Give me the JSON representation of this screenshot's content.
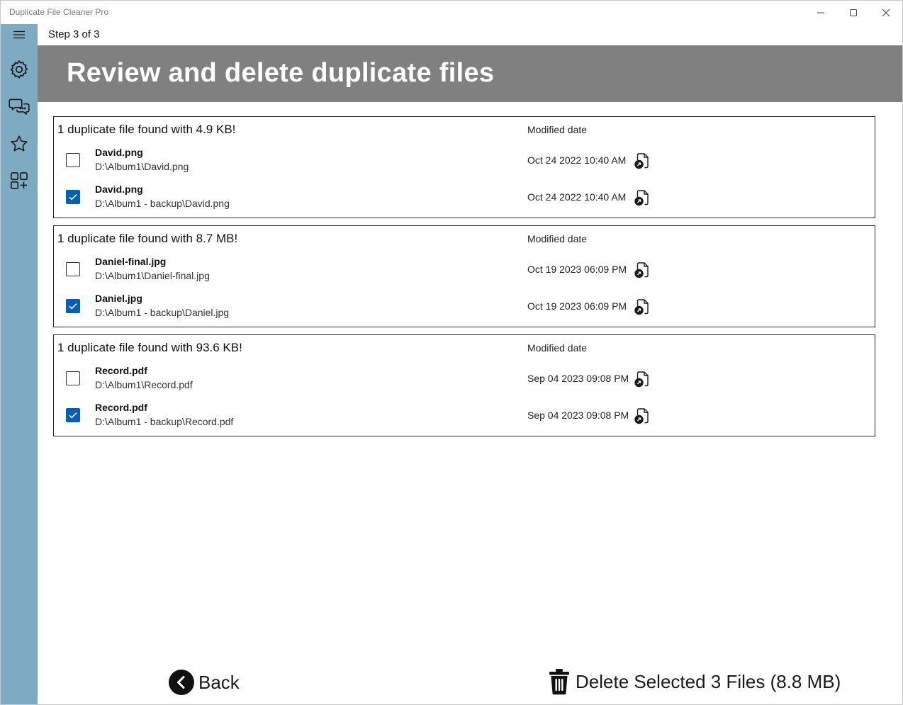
{
  "window": {
    "title": "Duplicate File Cleaner Pro",
    "controls": [
      "minimize-icon",
      "maximize-icon",
      "close-icon"
    ]
  },
  "sidebar": {
    "items": [
      {
        "icon": "hamburger-menu-icon"
      },
      {
        "icon": "gear-icon"
      },
      {
        "icon": "chat-bubbles-icon"
      },
      {
        "icon": "star-icon"
      },
      {
        "icon": "apps-add-icon"
      }
    ]
  },
  "step": {
    "label": "Step 3 of 3"
  },
  "banner": {
    "title": "Review and delete duplicate files"
  },
  "groups": [
    {
      "header": "1 duplicate file found with 4.9 KB!",
      "date_header": "Modified date",
      "files": [
        {
          "name": "David.png",
          "path": "D:\\Album1\\David.png",
          "date": "Oct 24 2022 10:40 AM",
          "checked": false
        },
        {
          "name": "David.png",
          "path": "D:\\Album1 - backup\\David.png",
          "date": "Oct 24 2022 10:40 AM",
          "checked": true
        }
      ]
    },
    {
      "header": "1 duplicate file found with 8.7 MB!",
      "date_header": "Modified date",
      "files": [
        {
          "name": "Daniel-final.jpg",
          "path": "D:\\Album1\\Daniel-final.jpg",
          "date": "Oct 19 2023 06:09 PM",
          "checked": false
        },
        {
          "name": "Daniel.jpg",
          "path": "D:\\Album1 - backup\\Daniel.jpg",
          "date": "Oct 19 2023 06:09 PM",
          "checked": true
        }
      ]
    },
    {
      "header": "1 duplicate file found with 93.6 KB!",
      "date_header": "Modified date",
      "files": [
        {
          "name": "Record.pdf",
          "path": "D:\\Album1\\Record.pdf",
          "date": "Sep 04 2023 09:08 PM",
          "checked": false
        },
        {
          "name": "Record.pdf",
          "path": "D:\\Album1 - backup\\Record.pdf",
          "date": "Sep 04 2023 09:08 PM",
          "checked": true
        }
      ]
    }
  ],
  "footer": {
    "back_label": "Back",
    "delete_label": "Delete Selected 3 Files (8.8 MB)"
  },
  "colors": {
    "sidebar": "#7eabc2",
    "banner": "#808080",
    "checkbox_checked": "#005fb8"
  }
}
